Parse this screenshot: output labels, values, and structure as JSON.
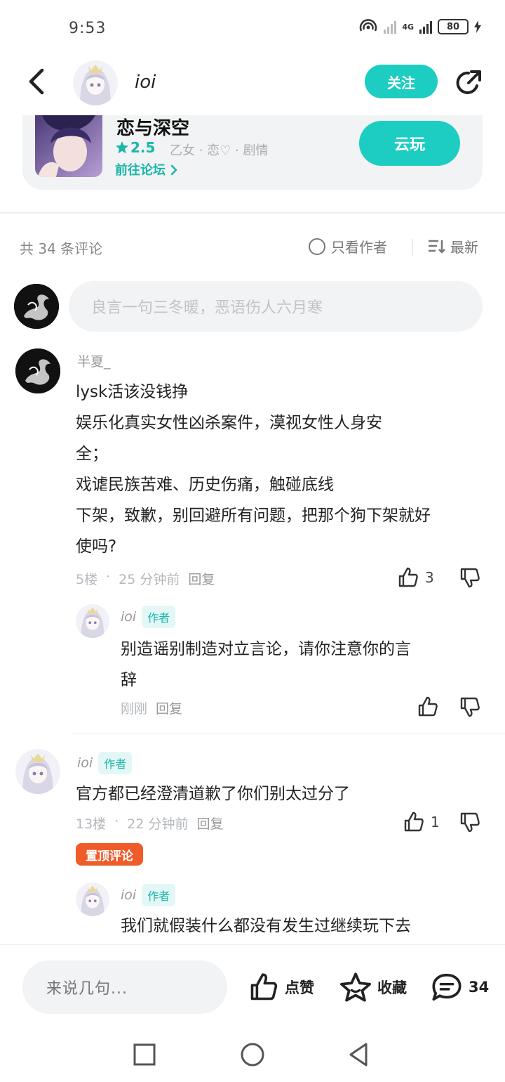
{
  "status_bar": {
    "time": "9:53",
    "net": "4G",
    "battery": "80"
  },
  "header": {
    "username": "ioi",
    "follow_label": "关注"
  },
  "game_card": {
    "title": "恋与深空",
    "rating": "2.5",
    "tags": "乙女 · 恋♡ · 剧情",
    "forum_link": "前往论坛",
    "play_label": "云玩"
  },
  "comments_header": {
    "count_label": "共 34 条评论",
    "only_author_label": "只看作者",
    "sort_label": "最新"
  },
  "comment_input": {
    "placeholder": "良言一句三冬暖，恶语伤人六月寒"
  },
  "comments": [
    {
      "user": "半夏_",
      "lines": [
        "lysk活该没钱挣",
        "娱乐化真实女性凶杀案件，漠视女性人身安",
        "全；",
        "戏谑民族苦难、历史伤痛，触碰底线",
        "下架，致歉，别回避所有问题，把那个狗下架就好",
        "使吗?"
      ],
      "floor": "5楼",
      "time": "25 分钟前",
      "reply_label": "回复",
      "likes": "3",
      "reply": {
        "user": "ioi",
        "author_tag": "作者",
        "lines": [
          "别造谣别制造对立言论，请你注意你的言",
          "辞"
        ],
        "time": "刚刚",
        "reply_label": "回复"
      }
    },
    {
      "user": "ioi",
      "author_tag": "作者",
      "lines": [
        "官方都已经澄清道歉了你们别太过分了"
      ],
      "floor": "13楼",
      "time": "22 分钟前",
      "reply_label": "回复",
      "likes": "1",
      "pinned_label": "置顶评论",
      "reply": {
        "user": "ioi",
        "author_tag": "作者",
        "lines": [
          "我们就假装什么都没有发生过继续玩下去"
        ]
      }
    }
  ],
  "bottom_bar": {
    "say_placeholder": "来说几句...",
    "like_label": "点赞",
    "fav_label": "收藏",
    "comment_count": "34"
  }
}
